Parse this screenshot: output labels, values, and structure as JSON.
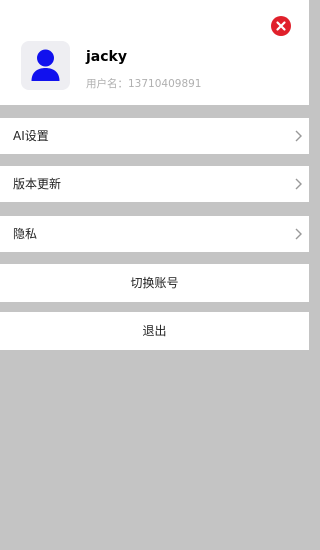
{
  "profile": {
    "username": "jacky",
    "account_label": "用户名：",
    "account_value": "13710409891"
  },
  "menu": [
    {
      "label": "AI设置"
    },
    {
      "label": "版本更新"
    },
    {
      "label": "隐私"
    }
  ],
  "actions": {
    "switch_account": "切换账号",
    "logout": "退出"
  },
  "icons": {
    "close": "close-icon",
    "avatar": "user-avatar-icon",
    "chevron": "chevron-right-icon"
  },
  "colors": {
    "close_red": "#e0202b",
    "avatar_blue": "#1111ee",
    "page_gray": "#c4c4c4"
  }
}
